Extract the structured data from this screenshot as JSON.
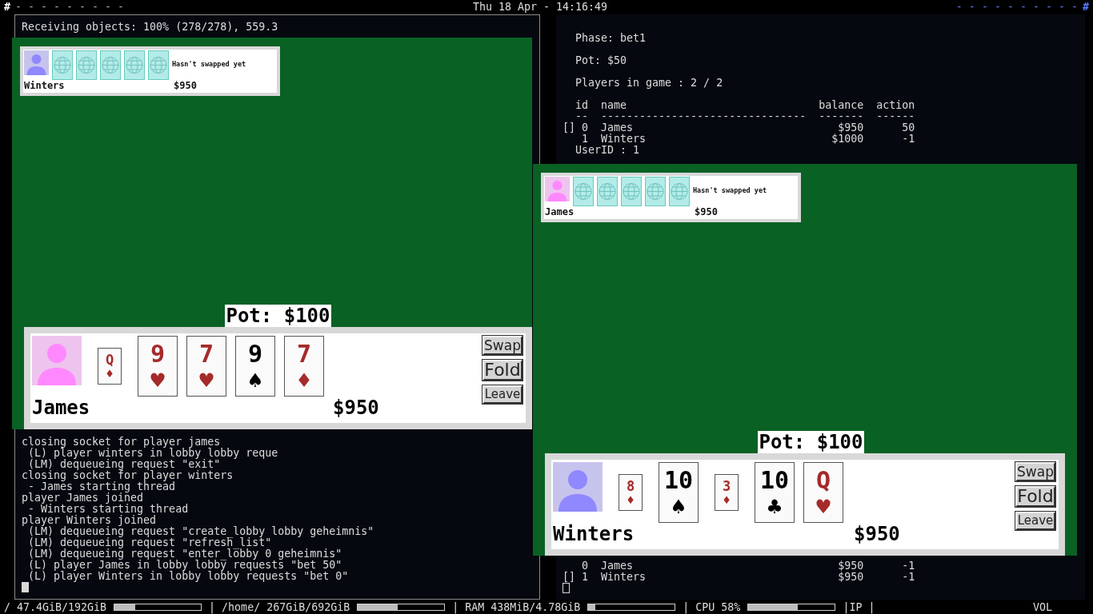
{
  "top_bar": {
    "left": "#",
    "left_dashes": "- - - - - - - - -",
    "clock": "Thu 18 Apr - 14:16:49",
    "right_dashes": "- - - - - - - - - -",
    "right": "#"
  },
  "left_terminal": {
    "top_lines": [
      "Receiving objects: 100% (278/278), 559.3"
    ],
    "bottom_lines": [
      "closing socket for player james",
      " (L) player winters in lobby lobby reque",
      " (LM) dequeueing request \"exit\"",
      "closing socket for player winters",
      " - James starting thread",
      "player James joined",
      " - Winters starting thread",
      "player Winters joined",
      " (LM) dequeueing request \"create_lobby lobby geheimnis\"",
      " (LM) dequeueing request \"refresh_list\"",
      " (LM) dequeueing request \"enter_lobby 0 geheimnis\"",
      " (L) player James in lobby lobby requests \"bet 50\"",
      " (L) player Winters in lobby lobby requests \"bet 0\""
    ]
  },
  "right_terminal": {
    "groups": [
      [
        "  Phase: bet1"
      ],
      [
        "  Pot: $50"
      ],
      [
        "  Players in game : 2 / 2"
      ],
      [
        "  id  name                              balance  action",
        "  --  --------------------------------  -------  ------",
        "[] 0  James                                $950      50",
        "   1  Winters                             $1000      -1",
        "  UserID : 1"
      ]
    ],
    "bottom_lines": [
      "   0  James                                $950      -1",
      "[] 1  Winters                              $950      -1"
    ]
  },
  "games": [
    {
      "opponent": {
        "name": "Winters",
        "balance": "$950",
        "status": "Hasn't swapped yet",
        "color": "#8f88ff",
        "cards": [
          {
            "kind": "back"
          },
          {
            "kind": "back"
          },
          {
            "kind": "back"
          },
          {
            "kind": "back"
          },
          {
            "kind": "back"
          }
        ]
      },
      "pot": "Pot: $100",
      "player": {
        "name": "James",
        "balance": "$950",
        "color": "#ff88ff",
        "cards": [
          {
            "rank": "Q",
            "suit": "♦",
            "kind": "small",
            "color": "#a52a2a"
          },
          {
            "rank": "9",
            "suit": "♥",
            "kind": "large",
            "color": "#a52a2a"
          },
          {
            "rank": "7",
            "suit": "♥",
            "kind": "large",
            "color": "#a52a2a"
          },
          {
            "rank": "9",
            "suit": "♠",
            "kind": "large",
            "color": "#000000"
          },
          {
            "rank": "7",
            "suit": "♦",
            "kind": "large",
            "color": "#a52a2a"
          }
        ]
      },
      "buttons": [
        "Swap",
        "Fold",
        "Leave"
      ]
    },
    {
      "opponent": {
        "name": "James",
        "balance": "$950",
        "status": "Hasn't swapped yet",
        "color": "#ff88ff",
        "cards": [
          {
            "kind": "back"
          },
          {
            "kind": "back"
          },
          {
            "kind": "back"
          },
          {
            "kind": "back"
          },
          {
            "kind": "back"
          }
        ]
      },
      "pot": "Pot: $100",
      "player": {
        "name": "Winters",
        "balance": "$950",
        "color": "#8f88ff",
        "cards": [
          {
            "rank": "8",
            "suit": "♦",
            "kind": "small",
            "color": "#a52a2a"
          },
          {
            "rank": "10",
            "suit": "♠",
            "kind": "large",
            "color": "#000000"
          },
          {
            "rank": "3",
            "suit": "♦",
            "kind": "small",
            "color": "#a52a2a"
          },
          {
            "rank": "10",
            "suit": "♣",
            "kind": "large",
            "color": "#000000"
          },
          {
            "rank": "Q",
            "suit": "♥",
            "kind": "large",
            "color": "#a52a2a"
          }
        ]
      },
      "buttons": [
        "Swap",
        "Fold",
        "Leave"
      ]
    }
  ],
  "status_bar": {
    "meters": [
      {
        "label": "/ 47.4GiB/192GiB",
        "level": 0.24
      },
      {
        "label": "| /home/ 267GiB/692GiB",
        "level": 0.46
      },
      {
        "label": "| RAM 438MiB/4.78GiB",
        "level": 0.08
      },
      {
        "label": "| CPU 58%",
        "level": 0.57
      }
    ],
    "ip": "|IP |",
    "vol": "VOL"
  }
}
